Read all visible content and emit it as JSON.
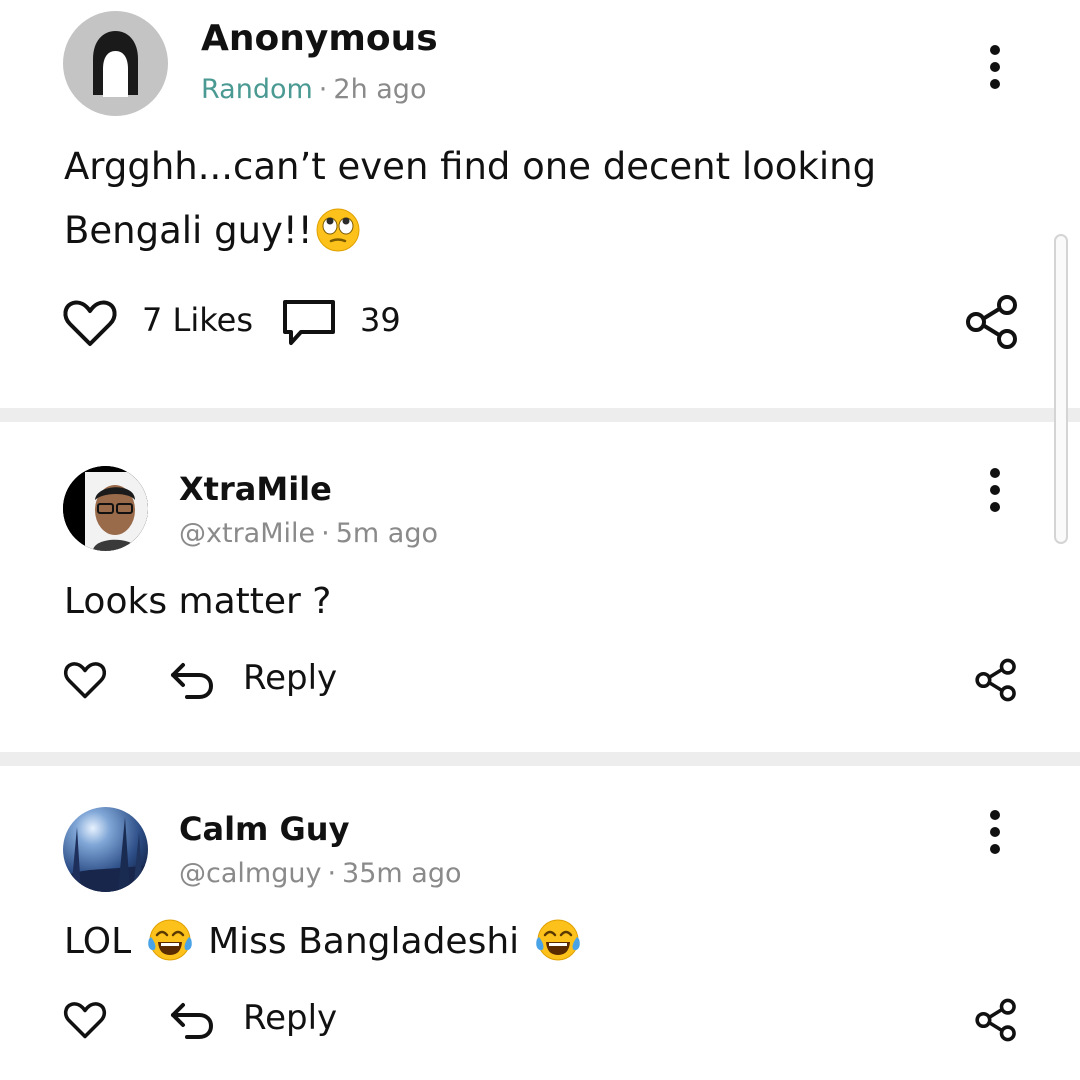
{
  "post": {
    "author": "Anonymous",
    "tag": "Random",
    "time": "2h ago",
    "text_line1": "Argghh...can’t even find one decent looking",
    "text_line2": "Bengali guy!!",
    "likes_label": "7 Likes",
    "comments_count": "39"
  },
  "comments": [
    {
      "author": "XtraMile",
      "handle": "@xtraMile",
      "time": "5m ago",
      "text": "Looks matter ?",
      "reply_label": "Reply"
    },
    {
      "author": "Calm Guy",
      "handle": "@calmguy",
      "time": "35m ago",
      "text_part1": "LOL",
      "text_part2": "Miss Bangladeshi",
      "reply_label": "Reply"
    }
  ],
  "colors": {
    "tag": "#4a9a93",
    "meta": "#8a8a8a",
    "divider": "#ededed",
    "text": "#111111"
  },
  "icons": [
    "avatar-placeholder-icon",
    "more-vertical-icon",
    "heart-icon",
    "comment-icon",
    "share-icon",
    "reply-icon",
    "eye-roll-emoji",
    "tears-of-joy-emoji"
  ]
}
